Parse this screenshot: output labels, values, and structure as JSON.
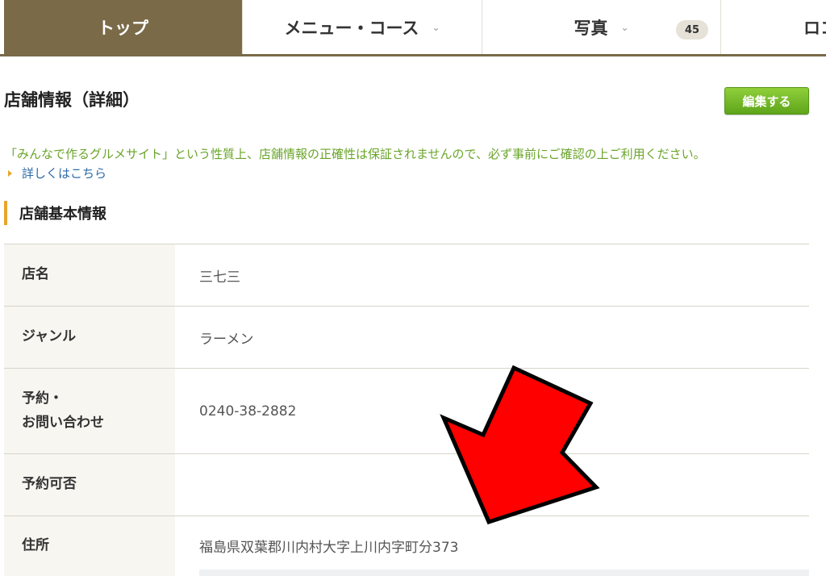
{
  "nav": {
    "tabs": [
      {
        "label": "トップ",
        "active": true
      },
      {
        "label": "メニュー・コース",
        "has_caret": true
      },
      {
        "label": "写真",
        "has_caret": true,
        "badge": "45"
      },
      {
        "label": "ロコ"
      }
    ],
    "caret": "⌄"
  },
  "header": {
    "title": "店舗情報（詳細）",
    "edit_label": "編集する"
  },
  "notice": {
    "text": "「みんなで作るグルメサイト」という性質上、店舗情報の正確性は保証されませんので、必ず事前にご確認の上ご利用ください。",
    "link_label": "詳しくはこちら"
  },
  "section": {
    "title": "店舗基本情報"
  },
  "table": {
    "rows": [
      {
        "label": "店名",
        "value": "三七三"
      },
      {
        "label": "ジャンル",
        "value": "ラーメン"
      },
      {
        "label": "予約・\nお問い合わせ",
        "label_line1": "予約・",
        "label_line2": "お問い合わせ",
        "value": "0240-38-2882"
      },
      {
        "label": "予約可否",
        "value": ""
      },
      {
        "label": "住所",
        "value": "福島県双葉郡川内村大字上川内字町分373"
      }
    ]
  },
  "colors": {
    "nav_active": "#7a6a48",
    "notice_green": "#6aa52a",
    "link_blue": "#2e6aa8",
    "accent_orange": "#e8a52a",
    "edit_button": "#6cb524",
    "arrow_red": "#ff0000"
  }
}
